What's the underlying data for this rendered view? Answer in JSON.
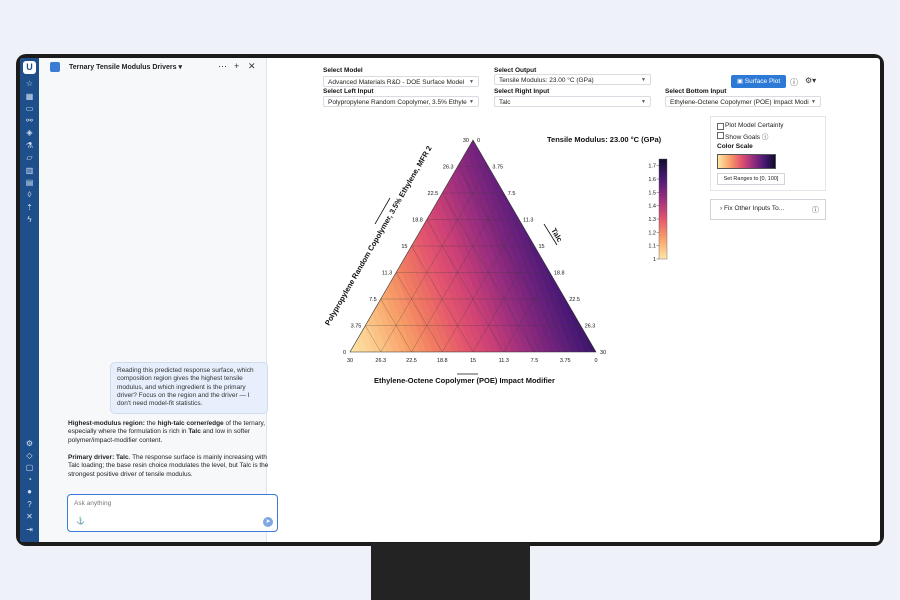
{
  "chat": {
    "title": "Ternary Tensile Modulus Drivers",
    "actions": [
      "⋯",
      "+",
      "✕"
    ],
    "user_message": "Reading this predicted response surface, which composition region gives the highest tensile modulus, and which ingredient is the primary driver? Focus on the region and the driver — I don't need model-fit statistics.",
    "answer1_head": "Highest-modulus region:",
    "answer1_pre": " the ",
    "answer1_bold": "high-talc corner/edge",
    "answer1_mid": " of the ternary, especially where the formulation is rich in ",
    "answer1_bold2": "Talc",
    "answer1_tail": " and low in softer polymer/impact-modifier content.",
    "answer2_head": "Primary driver: Talc",
    "answer2_tail": ". The response surface is mainly increasing with Talc loading; the base resin choice modulates the level, but Talc is the strongest positive driver of tensile modulus.",
    "input_placeholder": "Ask anything"
  },
  "controls": {
    "model_label": "Select Model",
    "model_value": "Advanced Materials R&D - DOE Surface Model",
    "output_label": "Select Output",
    "output_value": "Tensile Modulus: 23.00 °C (GPa)",
    "left_label": "Select Left Input",
    "left_value": "Polypropylene Random Copolymer, 3.5% Ethyle",
    "right_label": "Select Right Input",
    "right_value": "Talc",
    "bottom_label": "Select Bottom Input",
    "bottom_value": "Ethylene-Octene Copolymer (POE) Impact Modi",
    "surface_plot": "Surface Plot"
  },
  "settings": {
    "certainty": "Plot Model Certainty",
    "goals": "Show Goals",
    "color_scale": "Color Scale",
    "set_ranges": "Set Ranges to [0, 100]",
    "fix_inputs": "Fix Other Inputs To..."
  },
  "chart_data": {
    "type": "heatmap",
    "title": "Tensile Modulus: 23.00 °C (GPa)",
    "left_axis": "Polypropylene Random Copolymer, 3.5% Ethylene, MFR 2",
    "right_axis": "Talc",
    "bottom_axis": "Ethylene-Octene Copolymer (POE) Impact Modifier",
    "ticks": [
      "0",
      "3.75",
      "7.5",
      "11.3",
      "15",
      "18.8",
      "22.5",
      "26.3",
      "30"
    ],
    "colorbar_ticks": [
      "1",
      "1.1",
      "1.2",
      "1.3",
      "1.4",
      "1.5",
      "1.6",
      "1.7"
    ],
    "colorbar_range": [
      1.0,
      1.75
    ],
    "ternary_range": [
      0,
      30
    ]
  }
}
